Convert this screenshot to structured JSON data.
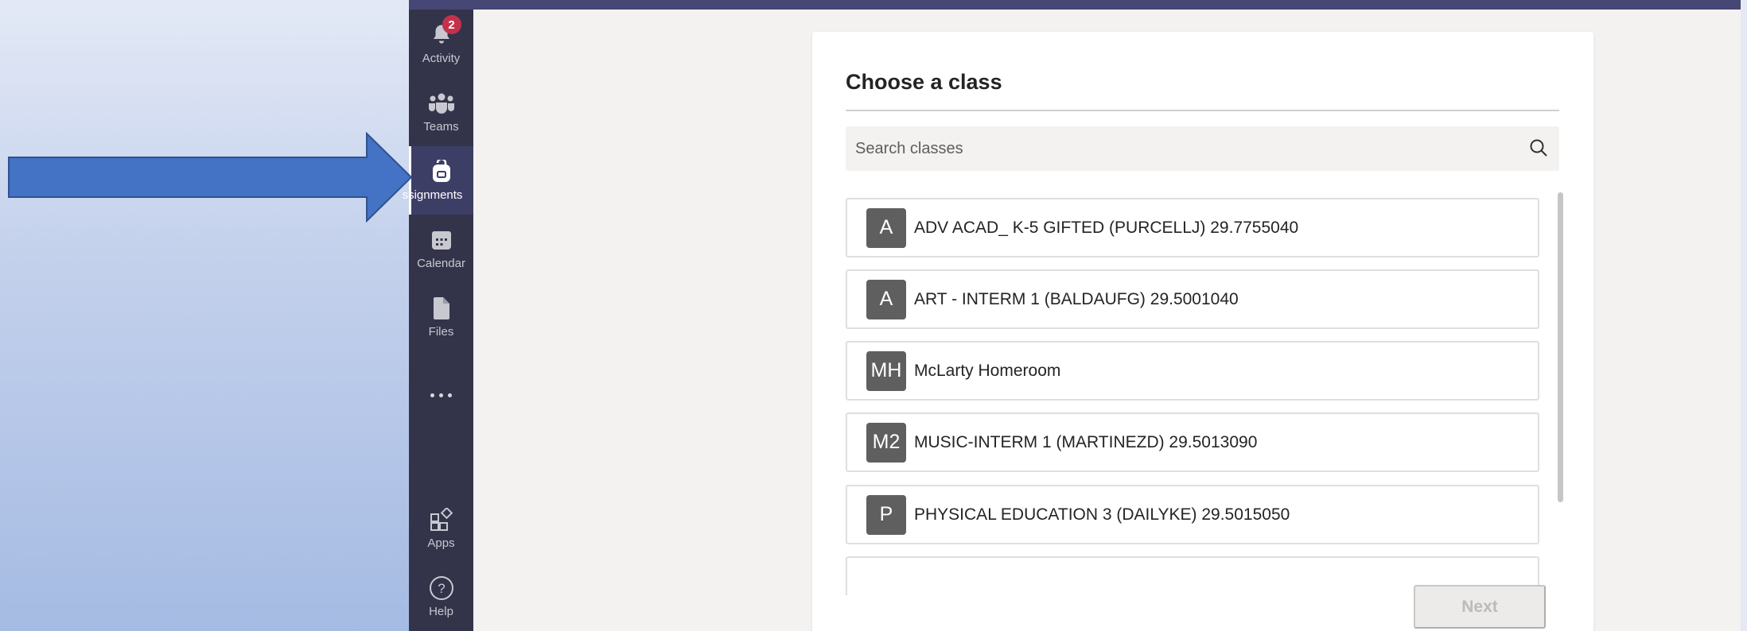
{
  "rail": {
    "items": [
      {
        "label": "Activity",
        "icon": "bell-icon",
        "badge": "2"
      },
      {
        "label": "Teams",
        "icon": "teams-icon"
      },
      {
        "label": "ssignments",
        "icon": "backpack-icon"
      },
      {
        "label": "Calendar",
        "icon": "calendar-icon"
      },
      {
        "label": "Files",
        "icon": "file-icon"
      }
    ],
    "more_icon": "more-icon",
    "bottom": [
      {
        "label": "Apps",
        "icon": "apps-icon"
      },
      {
        "label": "Help",
        "icon": "help-icon"
      }
    ]
  },
  "dialog": {
    "title": "Choose a class",
    "search": {
      "placeholder": "Search classes"
    },
    "classes": [
      {
        "initials": "A",
        "name": "ADV ACAD_ K-5 GIFTED (PURCELLJ) 29.7755040"
      },
      {
        "initials": "A",
        "name": "ART - INTERM 1 (BALDAUFG) 29.5001040"
      },
      {
        "initials": "MH",
        "name": "McLarty Homeroom"
      },
      {
        "initials": "M2",
        "name": "MUSIC-INTERM 1 (MARTINEZD) 29.5013090"
      },
      {
        "initials": "P",
        "name": "PHYSICAL EDUCATION 3 (DAILYKE) 29.5015050"
      }
    ],
    "next_label": "Next"
  },
  "colors": {
    "rail_bg": "#33344a",
    "topbar": "#464775",
    "arrow": "#4472c4",
    "badge": "#c4314b"
  }
}
